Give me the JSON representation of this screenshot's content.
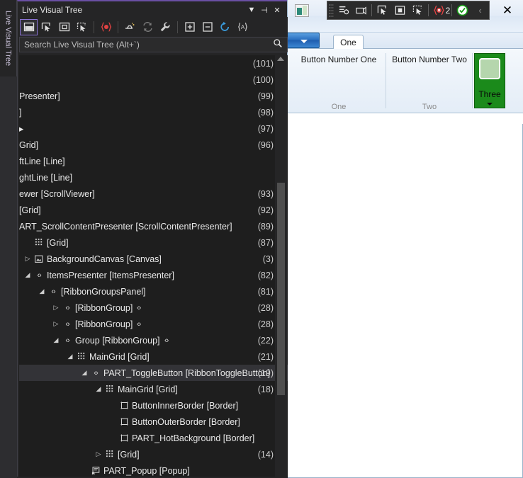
{
  "side_tab": {
    "label": "Live Visual Tree"
  },
  "tool_window": {
    "title": "Live Visual Tree",
    "window_buttons": [
      {
        "name": "dropdown",
        "glyph": "▼"
      },
      {
        "name": "dock",
        "glyph": "⊣"
      },
      {
        "name": "close",
        "glyph": "✕"
      }
    ],
    "toolbar": [
      {
        "name": "select-element-icon",
        "glyph": "▣",
        "active": true
      },
      {
        "name": "display-layout-adorner-icon",
        "glyph": "⊐"
      },
      {
        "name": "preview-selection-icon",
        "glyph": "▣"
      },
      {
        "name": "track-focused-element-icon",
        "glyph": "⊞"
      },
      {
        "name": "xaml-breakpoint-icon",
        "glyph": "{◉}"
      },
      {
        "name": "show-just-my-xaml-icon",
        "glyph": "⇥"
      },
      {
        "name": "refresh-tree-icon",
        "glyph": "⟳"
      },
      {
        "name": "properties-wrench-icon",
        "glyph": "🔧"
      },
      {
        "name": "expand-all-icon",
        "glyph": "⊞"
      },
      {
        "name": "collapse-all-icon",
        "glyph": "⊟"
      },
      {
        "name": "reload-icon",
        "glyph": "↻"
      },
      {
        "name": "anonymous-type-icon",
        "glyph": "{A}"
      }
    ],
    "search": {
      "placeholder": "Search Live Visual Tree (Alt+`)",
      "value": "",
      "icon": "search-icon"
    }
  },
  "tree": {
    "rows": [
      {
        "indent": 0,
        "expander": "",
        "icon": "",
        "label": "",
        "count": "(101)",
        "selected": false,
        "extra": ""
      },
      {
        "indent": 0,
        "expander": "",
        "icon": "",
        "label": "",
        "count": "(100)",
        "selected": false,
        "extra": ""
      },
      {
        "indent": 0,
        "expander": "",
        "icon": "",
        "label": "Presenter]",
        "count": "(99)",
        "selected": false,
        "extra": ""
      },
      {
        "indent": 0,
        "expander": "",
        "icon": "",
        "label": "]",
        "count": "(98)",
        "selected": false,
        "extra": ""
      },
      {
        "indent": 0,
        "expander": "",
        "icon": "",
        "label": "▸",
        "count": "(97)",
        "selected": false,
        "extra": ""
      },
      {
        "indent": 0,
        "expander": "",
        "icon": "",
        "label": "Grid]",
        "count": "(96)",
        "selected": false,
        "extra": ""
      },
      {
        "indent": 0,
        "expander": "",
        "icon": "",
        "label": "ftLine [Line]",
        "count": "",
        "selected": false,
        "extra": ""
      },
      {
        "indent": 0,
        "expander": "",
        "icon": "",
        "label": "ghtLine [Line]",
        "count": "",
        "selected": false,
        "extra": ""
      },
      {
        "indent": 0,
        "expander": "",
        "icon": "",
        "label": "ewer [ScrollViewer]",
        "count": "(93)",
        "selected": false,
        "extra": ""
      },
      {
        "indent": 0,
        "expander": "",
        "icon": "",
        "label": "[Grid]",
        "count": "(92)",
        "selected": false,
        "extra": ""
      },
      {
        "indent": 0,
        "expander": "",
        "icon": "",
        "label": "ART_ScrollContentPresenter [ScrollContentPresenter]",
        "count": "(89)",
        "selected": false,
        "extra": ""
      },
      {
        "indent": 0,
        "expander": "",
        "icon": "grid-icon",
        "label": "[Grid]",
        "count": "(87)",
        "selected": false,
        "extra": ""
      },
      {
        "indent": 0,
        "expander": "▷",
        "icon": "canvas-icon",
        "label": "BackgroundCanvas [Canvas]",
        "count": "(3)",
        "selected": false,
        "extra": ""
      },
      {
        "indent": 0,
        "expander": "◢",
        "icon": "element-icon",
        "label": "ItemsPresenter [ItemsPresenter]",
        "count": "(82)",
        "selected": false,
        "extra": ""
      },
      {
        "indent": 1,
        "expander": "◢",
        "icon": "element-icon",
        "label": "[RibbonGroupsPanel]",
        "count": "(81)",
        "selected": false,
        "extra": ""
      },
      {
        "indent": 2,
        "expander": "▷",
        "icon": "element-icon",
        "label": "[RibbonGroup]",
        "count": "(28)",
        "selected": false,
        "extra": "‹›"
      },
      {
        "indent": 2,
        "expander": "▷",
        "icon": "element-icon",
        "label": "[RibbonGroup]",
        "count": "(28)",
        "selected": false,
        "extra": "‹›"
      },
      {
        "indent": 2,
        "expander": "◢",
        "icon": "element-icon",
        "label": "Group [RibbonGroup]",
        "count": "(22)",
        "selected": false,
        "extra": "‹›"
      },
      {
        "indent": 3,
        "expander": "◢",
        "icon": "grid-icon",
        "label": "MainGrid [Grid]",
        "count": "(21)",
        "selected": false,
        "extra": ""
      },
      {
        "indent": 4,
        "expander": "◢",
        "icon": "element-icon",
        "label": "PART_ToggleButton [RibbonToggleButton]",
        "count": "(19)",
        "selected": true,
        "extra": ""
      },
      {
        "indent": 5,
        "expander": "◢",
        "icon": "grid-icon",
        "label": "MainGrid [Grid]",
        "count": "(18)",
        "selected": false,
        "extra": ""
      },
      {
        "indent": 6,
        "expander": "",
        "icon": "border-icon",
        "label": "ButtonInnerBorder [Border]",
        "count": "",
        "selected": false,
        "extra": ""
      },
      {
        "indent": 6,
        "expander": "",
        "icon": "border-icon",
        "label": "ButtonOuterBorder [Border]",
        "count": "",
        "selected": false,
        "extra": ""
      },
      {
        "indent": 6,
        "expander": "",
        "icon": "border-icon",
        "label": "PART_HotBackground [Border]",
        "count": "",
        "selected": false,
        "extra": ""
      },
      {
        "indent": 5,
        "expander": "▷",
        "icon": "grid-icon",
        "label": "[Grid]",
        "count": "(14)",
        "selected": false,
        "extra": ""
      },
      {
        "indent": 4,
        "expander": "",
        "icon": "popup-icon",
        "label": "PART_Popup [Popup]",
        "count": "",
        "selected": false,
        "extra": ""
      }
    ]
  },
  "app": {
    "close_glyph": "✕",
    "icon_name": "app-window-icon",
    "inapp_toolbar": [
      {
        "name": "go-to-live-visual-tree-icon",
        "glyph": "▤"
      },
      {
        "name": "record-icon",
        "glyph": "▭"
      },
      {
        "name": "select-element-icon",
        "glyph": "⊐"
      },
      {
        "name": "display-layout-adorner-icon",
        "glyph": "▣"
      },
      {
        "name": "track-focused-element-icon",
        "glyph": "⊞"
      },
      {
        "name": "xaml-binding-failures-icon",
        "glyph": "{◉}"
      },
      {
        "name": "xaml-binding-failure-count",
        "glyph": "2"
      },
      {
        "name": "hot-reload-status-icon",
        "glyph": "✓"
      },
      {
        "name": "collapse-toolbar-icon",
        "glyph": "‹"
      }
    ],
    "ribbon": {
      "app_menu_name": "application-menu-button",
      "tabs": [
        {
          "label": "One",
          "selected": true
        }
      ],
      "groups": [
        {
          "name": "one",
          "label": "One",
          "button_label": "Button Number One"
        },
        {
          "name": "two",
          "label": "Two",
          "button_label": "Button Number Two"
        },
        {
          "name": "three",
          "label": "",
          "toggle_label": "Three"
        }
      ]
    }
  },
  "colors": {
    "accent_purple": "#6a4fa3",
    "tree_bg": "#1e1e1e",
    "selection": "#333337",
    "ribbon_green": "#1b8a1b",
    "ribbon_blue": "#2a6fc0"
  }
}
